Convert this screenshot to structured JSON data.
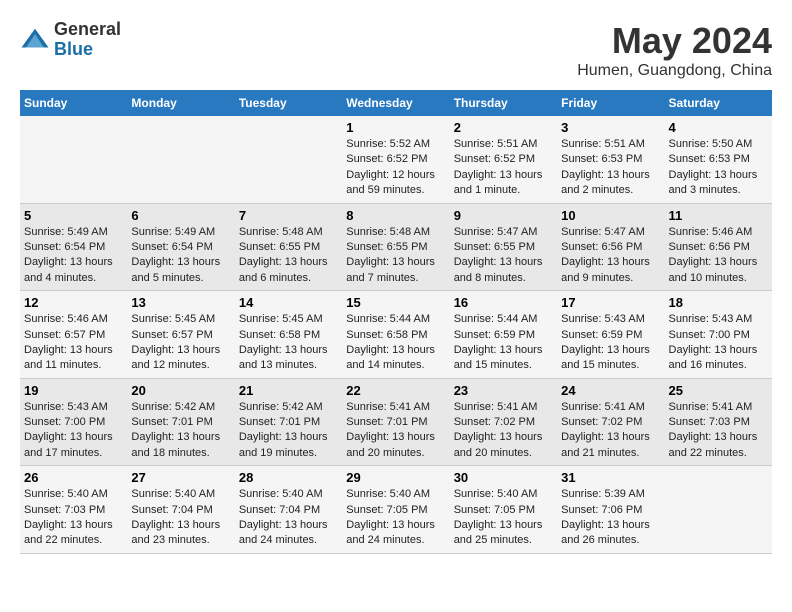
{
  "logo": {
    "general": "General",
    "blue": "Blue"
  },
  "title": "May 2024",
  "subtitle": "Humen, Guangdong, China",
  "days_of_week": [
    "Sunday",
    "Monday",
    "Tuesday",
    "Wednesday",
    "Thursday",
    "Friday",
    "Saturday"
  ],
  "weeks": [
    [
      {
        "day": "",
        "info": ""
      },
      {
        "day": "",
        "info": ""
      },
      {
        "day": "",
        "info": ""
      },
      {
        "day": "1",
        "info": "Sunrise: 5:52 AM\nSunset: 6:52 PM\nDaylight: 12 hours and 59 minutes."
      },
      {
        "day": "2",
        "info": "Sunrise: 5:51 AM\nSunset: 6:52 PM\nDaylight: 13 hours and 1 minute."
      },
      {
        "day": "3",
        "info": "Sunrise: 5:51 AM\nSunset: 6:53 PM\nDaylight: 13 hours and 2 minutes."
      },
      {
        "day": "4",
        "info": "Sunrise: 5:50 AM\nSunset: 6:53 PM\nDaylight: 13 hours and 3 minutes."
      }
    ],
    [
      {
        "day": "5",
        "info": "Sunrise: 5:49 AM\nSunset: 6:54 PM\nDaylight: 13 hours and 4 minutes."
      },
      {
        "day": "6",
        "info": "Sunrise: 5:49 AM\nSunset: 6:54 PM\nDaylight: 13 hours and 5 minutes."
      },
      {
        "day": "7",
        "info": "Sunrise: 5:48 AM\nSunset: 6:55 PM\nDaylight: 13 hours and 6 minutes."
      },
      {
        "day": "8",
        "info": "Sunrise: 5:48 AM\nSunset: 6:55 PM\nDaylight: 13 hours and 7 minutes."
      },
      {
        "day": "9",
        "info": "Sunrise: 5:47 AM\nSunset: 6:55 PM\nDaylight: 13 hours and 8 minutes."
      },
      {
        "day": "10",
        "info": "Sunrise: 5:47 AM\nSunset: 6:56 PM\nDaylight: 13 hours and 9 minutes."
      },
      {
        "day": "11",
        "info": "Sunrise: 5:46 AM\nSunset: 6:56 PM\nDaylight: 13 hours and 10 minutes."
      }
    ],
    [
      {
        "day": "12",
        "info": "Sunrise: 5:46 AM\nSunset: 6:57 PM\nDaylight: 13 hours and 11 minutes."
      },
      {
        "day": "13",
        "info": "Sunrise: 5:45 AM\nSunset: 6:57 PM\nDaylight: 13 hours and 12 minutes."
      },
      {
        "day": "14",
        "info": "Sunrise: 5:45 AM\nSunset: 6:58 PM\nDaylight: 13 hours and 13 minutes."
      },
      {
        "day": "15",
        "info": "Sunrise: 5:44 AM\nSunset: 6:58 PM\nDaylight: 13 hours and 14 minutes."
      },
      {
        "day": "16",
        "info": "Sunrise: 5:44 AM\nSunset: 6:59 PM\nDaylight: 13 hours and 15 minutes."
      },
      {
        "day": "17",
        "info": "Sunrise: 5:43 AM\nSunset: 6:59 PM\nDaylight: 13 hours and 15 minutes."
      },
      {
        "day": "18",
        "info": "Sunrise: 5:43 AM\nSunset: 7:00 PM\nDaylight: 13 hours and 16 minutes."
      }
    ],
    [
      {
        "day": "19",
        "info": "Sunrise: 5:43 AM\nSunset: 7:00 PM\nDaylight: 13 hours and 17 minutes."
      },
      {
        "day": "20",
        "info": "Sunrise: 5:42 AM\nSunset: 7:01 PM\nDaylight: 13 hours and 18 minutes."
      },
      {
        "day": "21",
        "info": "Sunrise: 5:42 AM\nSunset: 7:01 PM\nDaylight: 13 hours and 19 minutes."
      },
      {
        "day": "22",
        "info": "Sunrise: 5:41 AM\nSunset: 7:01 PM\nDaylight: 13 hours and 20 minutes."
      },
      {
        "day": "23",
        "info": "Sunrise: 5:41 AM\nSunset: 7:02 PM\nDaylight: 13 hours and 20 minutes."
      },
      {
        "day": "24",
        "info": "Sunrise: 5:41 AM\nSunset: 7:02 PM\nDaylight: 13 hours and 21 minutes."
      },
      {
        "day": "25",
        "info": "Sunrise: 5:41 AM\nSunset: 7:03 PM\nDaylight: 13 hours and 22 minutes."
      }
    ],
    [
      {
        "day": "26",
        "info": "Sunrise: 5:40 AM\nSunset: 7:03 PM\nDaylight: 13 hours and 22 minutes."
      },
      {
        "day": "27",
        "info": "Sunrise: 5:40 AM\nSunset: 7:04 PM\nDaylight: 13 hours and 23 minutes."
      },
      {
        "day": "28",
        "info": "Sunrise: 5:40 AM\nSunset: 7:04 PM\nDaylight: 13 hours and 24 minutes."
      },
      {
        "day": "29",
        "info": "Sunrise: 5:40 AM\nSunset: 7:05 PM\nDaylight: 13 hours and 24 minutes."
      },
      {
        "day": "30",
        "info": "Sunrise: 5:40 AM\nSunset: 7:05 PM\nDaylight: 13 hours and 25 minutes."
      },
      {
        "day": "31",
        "info": "Sunrise: 5:39 AM\nSunset: 7:06 PM\nDaylight: 13 hours and 26 minutes."
      },
      {
        "day": "",
        "info": ""
      }
    ]
  ]
}
